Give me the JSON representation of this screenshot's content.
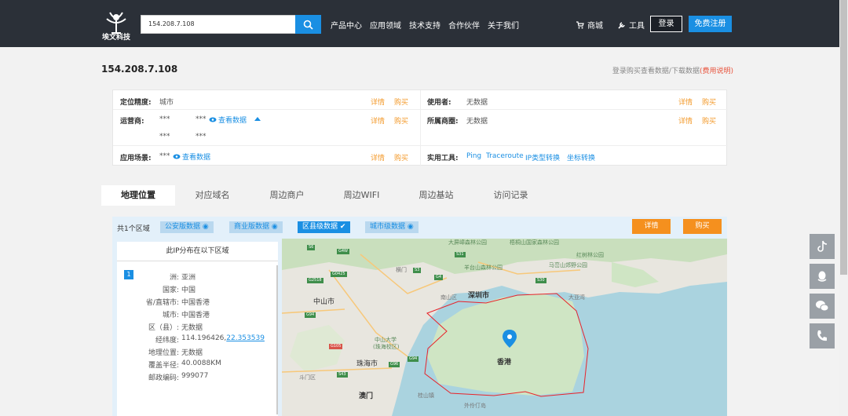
{
  "brand": {
    "name": "埃文科技"
  },
  "search": {
    "value": "154.208.7.108"
  },
  "nav": [
    "产品中心",
    "应用领域",
    "技术支持",
    "合作伙伴",
    "关于我们"
  ],
  "top_actions": {
    "cart": "商城",
    "tool": "工具",
    "login": "登录",
    "register": "免费注册"
  },
  "header": {
    "ip": "154.208.7.108",
    "buy_note": "登录购买查看数据/下载数据",
    "fee_link": "(费用说明)"
  },
  "info": {
    "precision_label": "定位精度:",
    "precision_value": "城市",
    "user_label": "使用者:",
    "user_value": "无数据",
    "isp_label": "运营商:",
    "isp_v1": "***",
    "isp_v2": "***",
    "isp_view": "查看数据",
    "isp_v3": "***",
    "isp_v4": "***",
    "circle_label": "所属商圈:",
    "circle_value": "无数据",
    "scene_label": "应用场景:",
    "scene_v1": "***",
    "scene_view": "查看数据",
    "tools_label": "实用工具:",
    "tools": [
      "Ping",
      "Traceroute",
      "IP类型转换",
      "坐标转换"
    ],
    "detail": "详情",
    "buy": "购买"
  },
  "tabs": [
    "地理位置",
    "对应域名",
    "周边商户",
    "周边WIFI",
    "周边基站",
    "访问记录"
  ],
  "filters": {
    "count": "共1个区域",
    "items": [
      "公安版数据",
      "商业版数据",
      "区县级数据",
      "城市级数据"
    ],
    "detail": "详情",
    "buy": "购买"
  },
  "location": {
    "title": "此IP分布在以下区域",
    "index": "1",
    "rows": [
      {
        "k": "洲:",
        "v": "亚洲"
      },
      {
        "k": "国家:",
        "v": "中国"
      },
      {
        "k": "省/直辖市:",
        "v": "中国香港"
      },
      {
        "k": "城市:",
        "v": "中国香港"
      },
      {
        "k": "区（县）:",
        "v": "无数据"
      },
      {
        "k": "经纬度:",
        "v": "114.196426,",
        "v2": "22.353539"
      },
      {
        "k": "地理位置:",
        "v": "无数据"
      },
      {
        "k": "覆盖半径:",
        "v": "40.0088KM"
      },
      {
        "k": "邮政编码:",
        "v": "999077"
      }
    ]
  },
  "map": {
    "labels": [
      "中山市",
      "中山大学",
      "(珠海校区)",
      "珠海市",
      "澳门",
      "斗门区",
      "深圳市",
      "香港",
      "南山区",
      "大屏嶂森林公园",
      "梧桐山国家森林公园",
      "红树林公园",
      "马峦山郊野公园",
      "羊台山森林公园",
      "横门",
      "外伶仃岛",
      "桂山镇",
      "大亚湾"
    ],
    "roads": [
      "G4",
      "S3",
      "G0425",
      "S31",
      "G2518",
      "S30",
      "G94",
      "G105",
      "S43",
      "G96",
      "G94",
      "S6",
      "G4W"
    ]
  },
  "colors": {
    "topbar": "#2b3038",
    "accent": "#1a8fe3",
    "orange": "#f5901e",
    "boundary": "#e8232a"
  }
}
